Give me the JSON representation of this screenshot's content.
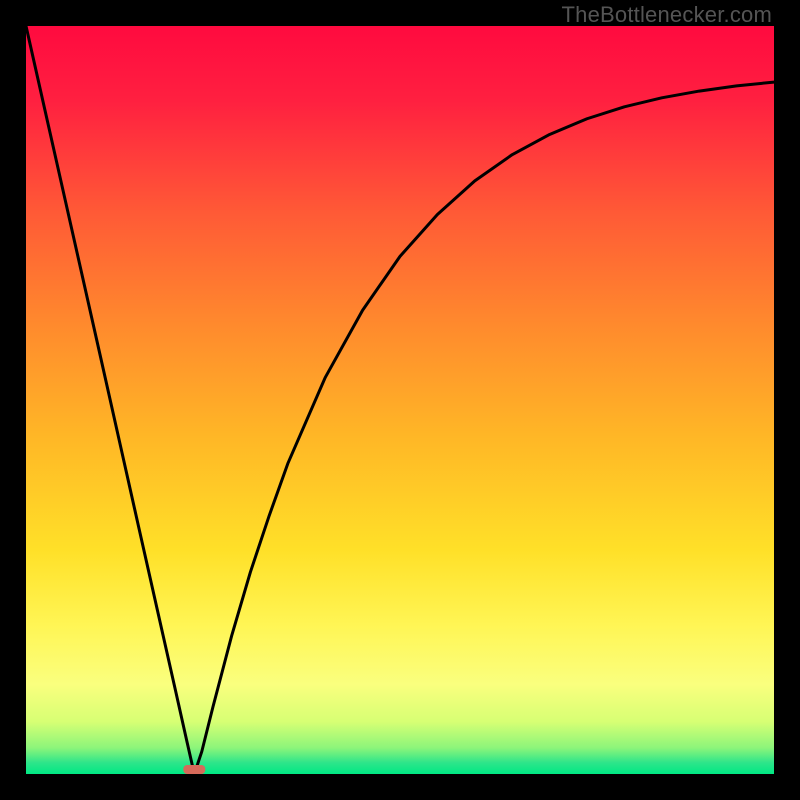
{
  "watermark": "TheBottlenecker.com",
  "chart_data": {
    "type": "line",
    "title": "",
    "xlabel": "",
    "ylabel": "",
    "xlim": [
      0,
      1
    ],
    "ylim": [
      0,
      100
    ],
    "optimum_x": 0.225,
    "marker": {
      "x": 0.225,
      "y": 0,
      "color": "#d66a5a"
    },
    "background_gradient": {
      "stops": [
        {
          "offset": 0.0,
          "color": "#ff0a3f"
        },
        {
          "offset": 0.1,
          "color": "#ff2040"
        },
        {
          "offset": 0.25,
          "color": "#ff5a36"
        },
        {
          "offset": 0.4,
          "color": "#ff8a2d"
        },
        {
          "offset": 0.55,
          "color": "#ffb726"
        },
        {
          "offset": 0.7,
          "color": "#ffe028"
        },
        {
          "offset": 0.8,
          "color": "#fff554"
        },
        {
          "offset": 0.88,
          "color": "#faff7e"
        },
        {
          "offset": 0.93,
          "color": "#d7ff74"
        },
        {
          "offset": 0.965,
          "color": "#8cf57a"
        },
        {
          "offset": 0.985,
          "color": "#2de58a"
        },
        {
          "offset": 1.0,
          "color": "#00e884"
        }
      ]
    },
    "series": [
      {
        "name": "bottleneck-curve",
        "x": [
          0.0,
          0.05,
          0.1,
          0.15,
          0.2,
          0.215,
          0.225,
          0.235,
          0.25,
          0.275,
          0.3,
          0.325,
          0.35,
          0.4,
          0.45,
          0.5,
          0.55,
          0.6,
          0.65,
          0.7,
          0.75,
          0.8,
          0.85,
          0.9,
          0.95,
          1.0
        ],
        "y": [
          100.0,
          77.8,
          55.6,
          33.3,
          11.1,
          4.4,
          0.0,
          3.0,
          9.0,
          18.5,
          27.0,
          34.5,
          41.5,
          53.0,
          62.0,
          69.2,
          74.8,
          79.3,
          82.8,
          85.5,
          87.6,
          89.2,
          90.4,
          91.3,
          92.0,
          92.5
        ]
      }
    ]
  }
}
